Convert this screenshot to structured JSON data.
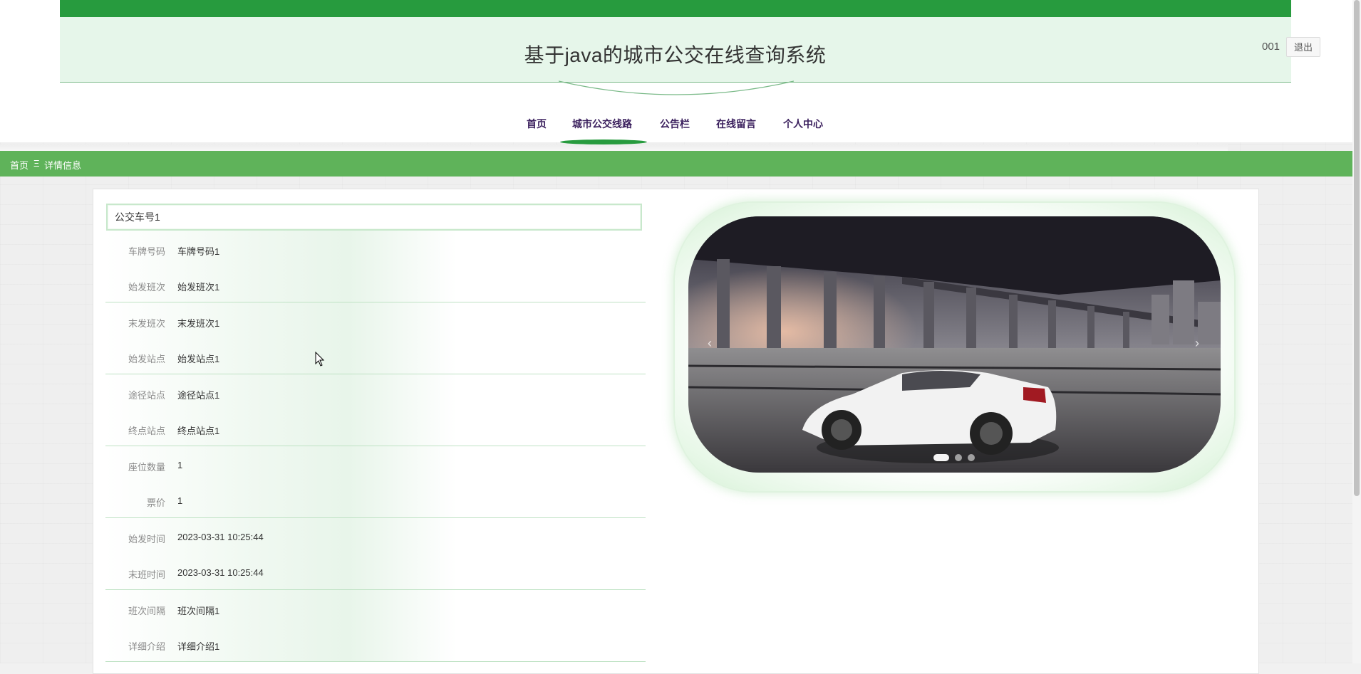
{
  "header": {
    "site_title": "基于java的城市公交在线查询系统",
    "username": "001",
    "logout_label": "退出",
    "brand_color": "#279b3e",
    "header_bg": "#e6f6ea"
  },
  "nav": {
    "items": [
      {
        "label": "首页",
        "active": false
      },
      {
        "label": "城市公交线路",
        "active": true
      },
      {
        "label": "公告栏",
        "active": false
      },
      {
        "label": "在线留言",
        "active": false
      },
      {
        "label": "个人中心",
        "active": false
      }
    ]
  },
  "breadcrumb": {
    "home": "首页",
    "separator": "Ξ",
    "current": "详情信息",
    "bar_color": "#5fb35a"
  },
  "detail": {
    "title": "公交车号1",
    "fields": [
      {
        "label": "车牌号码",
        "value": "车牌号码1"
      },
      {
        "label": "始发班次",
        "value": "始发班次1"
      },
      {
        "label": "末发班次",
        "value": "末发班次1"
      },
      {
        "label": "始发站点",
        "value": "始发站点1"
      },
      {
        "label": "途径站点",
        "value": "途径站点1"
      },
      {
        "label": "终点站点",
        "value": "终点站点1"
      },
      {
        "label": "座位数量",
        "value": "1"
      },
      {
        "label": "票价",
        "value": "1"
      },
      {
        "label": "始发时间",
        "value": "2023-03-31 10:25:44"
      },
      {
        "label": "末班时间",
        "value": "2023-03-31 10:25:44"
      },
      {
        "label": "班次间隔",
        "value": "班次间隔1"
      },
      {
        "label": "详细介绍",
        "value": "详细介绍1"
      }
    ]
  },
  "carousel": {
    "prev_icon": "chevron-left-icon",
    "next_icon": "chevron-right-icon",
    "slide_count": 3,
    "active_index": 0,
    "image_subject": "car-under-bridge-image"
  }
}
